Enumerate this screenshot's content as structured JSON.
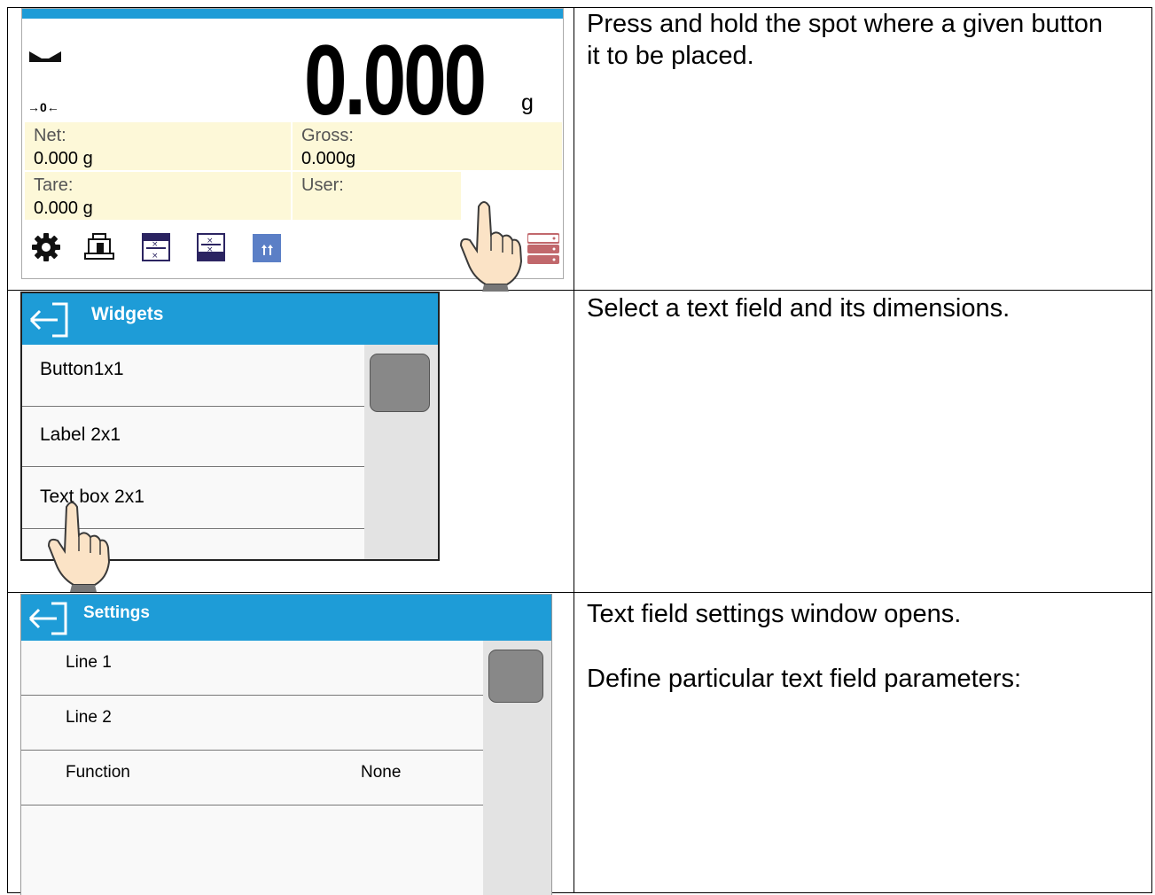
{
  "row1": {
    "description": "Press and hold the spot where a given button it to be placed.",
    "screen": {
      "weight": "0.000",
      "unit": "g",
      "zero_indicator": "→0←",
      "net_label": "Net:",
      "net_value": "0.000 g",
      "gross_label": "Gross:",
      "gross_value": "0.000g",
      "tare_label": "Tare:",
      "tare_value": "0.000 g",
      "user_label": "User:",
      "icons": [
        "gear-icon",
        "weight-icon",
        "formula-icon",
        "formula-alt-icon",
        "chart-icon",
        "database-icon"
      ],
      "colors": {
        "accent": "#1e9cd7",
        "field_bg": "#fdf8d8"
      }
    }
  },
  "row2": {
    "description": "Select a text field and its dimensions.",
    "panel": {
      "title": "Widgets",
      "items": [
        "Button1x1",
        "Label 2x1",
        "Text box 2x1"
      ]
    }
  },
  "row3": {
    "description_1": "Text field settings window opens.",
    "description_2": "Define particular text field parameters:",
    "panel": {
      "title": "Settings",
      "items": [
        {
          "label": "Line 1",
          "value": ""
        },
        {
          "label": "Line 2",
          "value": ""
        },
        {
          "label": "Function",
          "value": "None"
        }
      ]
    }
  }
}
